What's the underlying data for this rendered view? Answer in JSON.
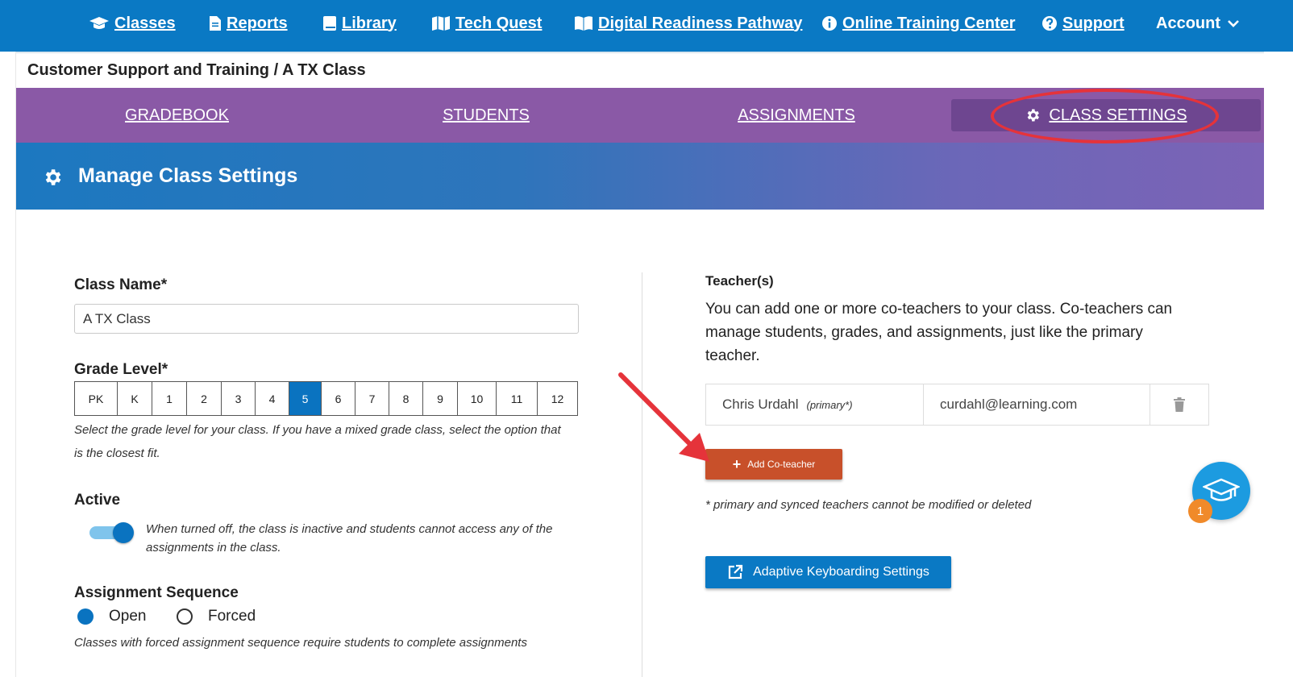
{
  "nav": {
    "items": [
      {
        "label": "Classes",
        "icon": "graduation-cap-icon"
      },
      {
        "label": "Reports",
        "icon": "document-icon"
      },
      {
        "label": "Library",
        "icon": "book-icon"
      },
      {
        "label": "Tech Quest",
        "icon": "map-icon"
      },
      {
        "label": "Digital Readiness Pathway",
        "icon": "open-book-icon"
      },
      {
        "label": "Online Training Center",
        "icon": "info-icon"
      },
      {
        "label": "Support",
        "icon": "question-icon"
      }
    ],
    "account_label": "Account"
  },
  "breadcrumb": "Customer Support and Training / A TX Class",
  "tabs": [
    {
      "label": "GRADEBOOK"
    },
    {
      "label": "STUDENTS"
    },
    {
      "label": "ASSIGNMENTS"
    },
    {
      "label": "CLASS SETTINGS",
      "active": true
    }
  ],
  "page_title": "Manage Class Settings",
  "form": {
    "class_name_label": "Class Name*",
    "class_name_value": "A TX Class",
    "grade_level_label": "Grade Level*",
    "grades": [
      "PK",
      "K",
      "1",
      "2",
      "3",
      "4",
      "5",
      "6",
      "7",
      "8",
      "9",
      "10",
      "11",
      "12"
    ],
    "selected_grade": "5",
    "grade_help_line1": "Select the grade level for your class. If you have a mixed grade class, select the option that",
    "grade_help_line2": "is the closest fit.",
    "active_label": "Active",
    "active_on": true,
    "active_help_line1": "When turned off, the class is inactive and students cannot access any of the",
    "active_help_line2": "assignments in the class.",
    "sequence_label": "Assignment Sequence",
    "sequence_options": [
      "Open",
      "Forced"
    ],
    "sequence_selected": "Open",
    "sequence_help": "Classes with forced assignment sequence require students to complete assignments"
  },
  "teachers": {
    "label": "Teacher(s)",
    "description": "You can add one or more co-teachers to your class. Co-teachers can manage students, grades, and assignments, just like the primary teacher.",
    "rows": [
      {
        "name": "Chris Urdahl",
        "tag": "(primary*)",
        "email": "curdahl@learning.com"
      }
    ],
    "add_button": "Add Co-teacher",
    "note": "* primary and synced teachers cannot be modified or deleted",
    "keyboarding_button": "Adaptive Keyboarding Settings"
  },
  "help_badge_count": "1",
  "colors": {
    "nav_blue": "#0a79c4",
    "tab_purple": "#8a59a6",
    "accent_orange": "#c8502a",
    "annotation_red": "#e5333a"
  }
}
